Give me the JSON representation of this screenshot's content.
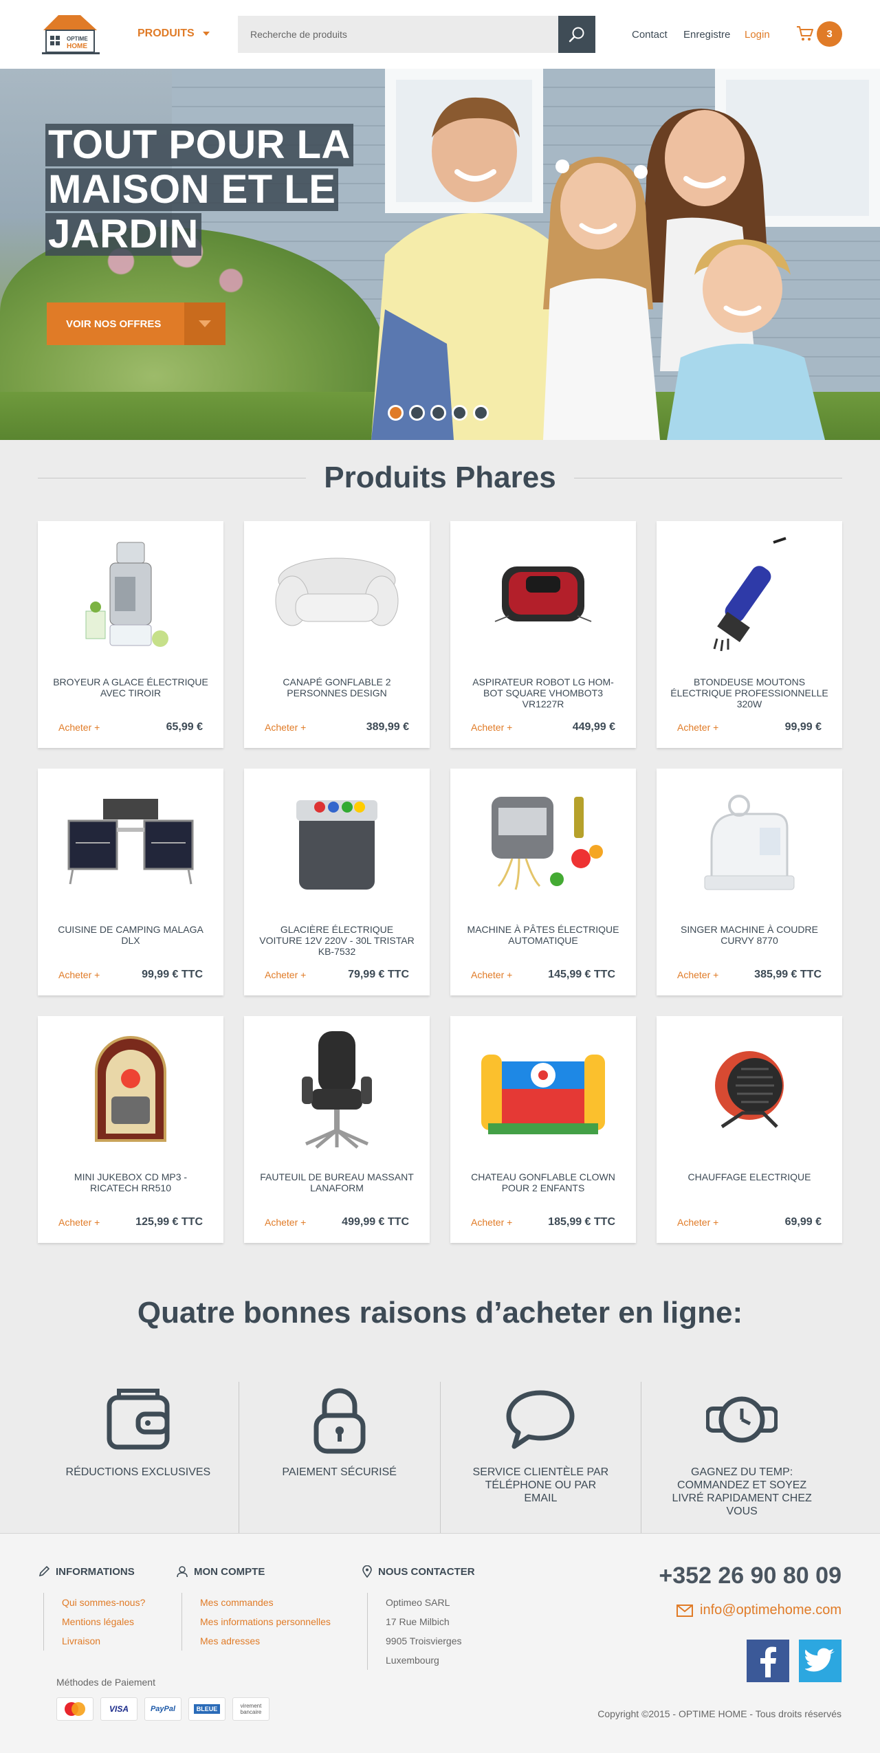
{
  "header": {
    "logo_line1": "OPTIME",
    "logo_line2": "HOME",
    "products_label": "PRODUITS",
    "search_placeholder": "Recherche de produits",
    "links": {
      "contact": "Contact",
      "register": "Enregistre",
      "login": "Login"
    },
    "cart_count": "3"
  },
  "hero": {
    "title_lines": [
      "TOUT POUR LA",
      "MAISON ET LE",
      "JARDIN"
    ],
    "cta_label": "VOIR NOS  OFFRES",
    "slides": 5,
    "active_slide": 1
  },
  "featured": {
    "title": "Produits Phares",
    "buy_label": "Acheter +",
    "products": [
      {
        "name": "BROYEUR A GLACE ÉLECTRIQUE AVEC TIROIR",
        "price": "65,99 €",
        "icon": "ice-crusher"
      },
      {
        "name": "CANAPÉ GONFLABLE 2 PERSONNES DESIGN",
        "price": "389,99 €",
        "icon": "inflatable-sofa"
      },
      {
        "name": "ASPIRATEUR ROBOT LG HOM-BOT SQUARE VHOMBOT3 VR1227R",
        "price": "449,99 €",
        "icon": "robot-vacuum"
      },
      {
        "name": "BTONDEUSE MOUTONS ÉLECTRIQUE PROFESSIONNELLE 320W",
        "price": "99,99 €",
        "icon": "sheep-shears"
      },
      {
        "name": "CUISINE DE CAMPING MALAGA DLX",
        "price": "99,99 € TTC",
        "icon": "camping-kitchen"
      },
      {
        "name": "GLACIÈRE ÉLECTRIQUE VOITURE 12V 220V - 30L TRISTAR KB-7532",
        "price": "79,99 € TTC",
        "icon": "cooler-box"
      },
      {
        "name": "MACHINE À PÂTES ÉLECTRIQUE AUTOMATIQUE",
        "price": "145,99 € TTC",
        "icon": "pasta-machine"
      },
      {
        "name": "SINGER MACHINE À COUDRE CURVY 8770",
        "price": "385,99 € TTC",
        "icon": "sewing-machine"
      },
      {
        "name": "MINI JUKEBOX CD MP3 - RICATECH RR510",
        "price": "125,99 € TTC",
        "icon": "jukebox"
      },
      {
        "name": "FAUTEUIL DE BUREAU MASSANT LANAFORM",
        "price": "499,99 € TTC",
        "icon": "office-chair"
      },
      {
        "name": "CHATEAU GONFLABLE CLOWN POUR 2 ENFANTS",
        "price": "185,99 € TTC",
        "icon": "bouncy-castle"
      },
      {
        "name": "CHAUFFAGE ELECTRIQUE",
        "price": "69,99 €",
        "icon": "electric-heater"
      }
    ]
  },
  "reasons": {
    "title": "Quatre bonnes raisons d’acheter en ligne:",
    "items": [
      {
        "label": "RÉDUCTIONS EXCLUSIVES",
        "icon": "wallet-icon"
      },
      {
        "label": "PAIEMENT SÉCURISÉ",
        "icon": "lock-icon"
      },
      {
        "label": "SERVICE CLIENTÈLE PAR TÉLÉPHONE OU PAR EMAIL",
        "icon": "chat-bubble-icon"
      },
      {
        "label": "GAGNEZ DU TEMP: COMMANDEZ ET SOYEZ LIVRÉ RAPIDAMENT CHEZ VOUS",
        "icon": "watch-icon"
      }
    ]
  },
  "footer": {
    "info": {
      "title": "INFORMATIONS",
      "links": [
        "Qui sommes-nous?",
        "Mentions légales",
        "Livraison"
      ]
    },
    "account": {
      "title": "MON COMPTE",
      "links": [
        "Mes commandes",
        "Mes informations personnelles",
        "Mes adresses"
      ]
    },
    "contact": {
      "title": "NOUS CONTACTER",
      "lines": [
        "Optimeo SARL",
        "17 Rue Milbich",
        "9905 Troisvierges",
        "Luxembourg"
      ]
    },
    "phone": "+352 26 90 80 09",
    "email": "info@optimehome.com",
    "payment_label": "Méthodes de Paiement",
    "payments": [
      "MasterCard",
      "VISA",
      "PayPal",
      "BLEUE",
      "virement bancaire"
    ],
    "copyright": "Copyright ©2015 - OPTIME HOME  - Tous droits réservés"
  },
  "colors": {
    "accent": "#e07b27",
    "dark": "#3d4a55",
    "background": "#ececec",
    "facebook": "#3b5998",
    "twitter": "#2ca7e0"
  }
}
